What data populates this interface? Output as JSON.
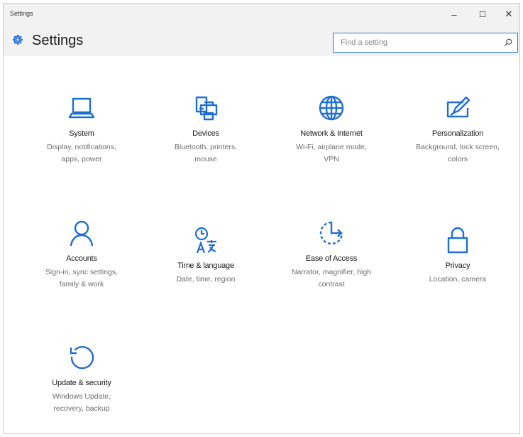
{
  "window": {
    "title": "Settings",
    "minimize_label": "–",
    "maximize_label": "☐",
    "close_label": "✕"
  },
  "header": {
    "icon": "gear-icon",
    "title": "Settings",
    "search_placeholder": "Find a setting",
    "search_value": "",
    "search_icon": "search-icon"
  },
  "tiles": [
    {
      "icon": "laptop-icon",
      "title": "System",
      "desc": "Display, notifications, apps, power"
    },
    {
      "icon": "devices-icon",
      "title": "Devices",
      "desc": "Bluetooth, printers, mouse"
    },
    {
      "icon": "globe-icon",
      "title": "Network & Internet",
      "desc": "Wi-Fi, airplane mode, VPN"
    },
    {
      "icon": "personalization-icon",
      "title": "Personalization",
      "desc": "Background, lock screen, colors"
    },
    {
      "icon": "person-icon",
      "title": "Accounts",
      "desc": "Sign-in, sync settings, family & work"
    },
    {
      "icon": "time-language-icon",
      "title": "Time & language",
      "desc": "Date, time, region"
    },
    {
      "icon": "ease-of-access-icon",
      "title": "Ease of Access",
      "desc": "Narrator, magnifier, high contrast"
    },
    {
      "icon": "lock-icon",
      "title": "Privacy",
      "desc": "Location, camera"
    },
    {
      "icon": "update-icon",
      "title": "Update & security",
      "desc": "Windows Update, recovery, backup"
    }
  ],
  "colors": {
    "accent": "#1f6fd2",
    "header_bg": "#f2f2f2",
    "search_border": "#2b6fd6",
    "desc_text": "#6d6d6d"
  }
}
